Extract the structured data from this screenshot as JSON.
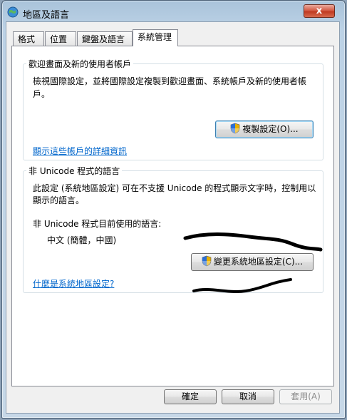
{
  "window": {
    "title": "地區及語言",
    "close_glyph": "x"
  },
  "tabs": [
    {
      "label": "格式",
      "active": false
    },
    {
      "label": "位置",
      "active": false
    },
    {
      "label": "鍵盤及語言",
      "active": false
    },
    {
      "label": "系統管理",
      "active": true
    }
  ],
  "welcome_group": {
    "title": "歡迎畫面及新的使用者帳戶",
    "description_line1": "檢視國際設定，並將國際設定複製到歡迎畫面、系統帳戶及新的使用者帳",
    "description_line2": "戶。",
    "copy_button": "複製設定(O)...",
    "details_link": "顯示這些帳戶的詳細資訊"
  },
  "unicode_group": {
    "title": "非 Unicode 程式的語言",
    "description_line1": "此設定 (系統地區設定) 可在不支援 Unicode 的程式顯示文字時，控制用以",
    "description_line2": "顯示的語言。",
    "current_label": "非 Unicode 程式目前使用的語言:",
    "current_value": "中文 (簡體，中國)",
    "change_button": "變更系統地區設定(C)...",
    "help_link": "什麼是系統地區設定?"
  },
  "footer": {
    "ok": "確定",
    "cancel": "取消",
    "apply": "套用(A)"
  },
  "icons": {
    "title": "globe-icon",
    "shield": "uac-shield-icon"
  }
}
